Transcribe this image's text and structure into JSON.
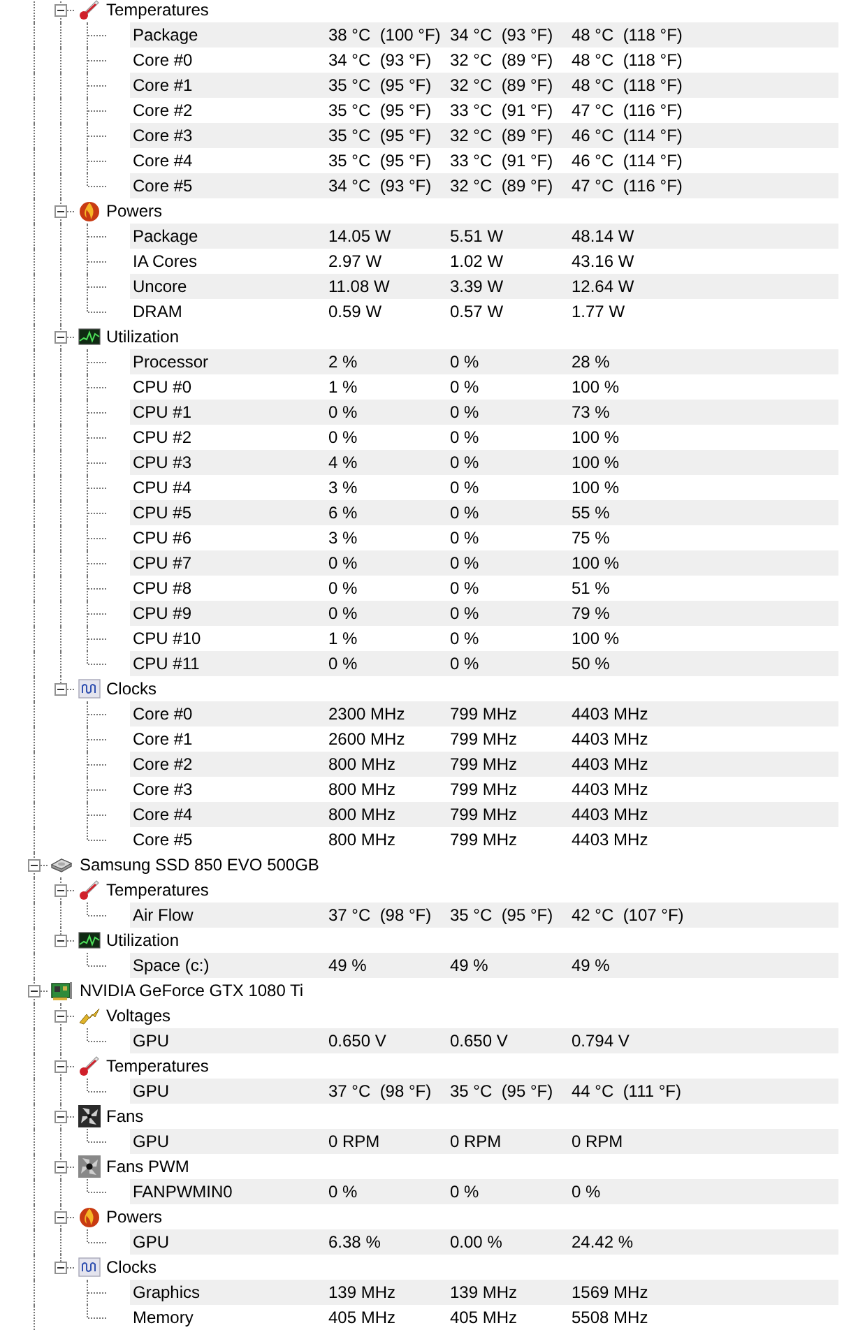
{
  "devices": [
    {
      "groups": [
        {
          "kind": "temperatures",
          "name": "Temperatures",
          "expanded": true,
          "sensors": [
            {
              "label": "Package",
              "values": [
                "38 °C  (100 °F)",
                "34 °C  (93 °F)",
                "48 °C  (118 °F)"
              ]
            },
            {
              "label": "Core #0",
              "values": [
                "34 °C  (93 °F)",
                "32 °C  (89 °F)",
                "48 °C  (118 °F)"
              ]
            },
            {
              "label": "Core #1",
              "values": [
                "35 °C  (95 °F)",
                "32 °C  (89 °F)",
                "48 °C  (118 °F)"
              ]
            },
            {
              "label": "Core #2",
              "values": [
                "35 °C  (95 °F)",
                "33 °C  (91 °F)",
                "47 °C  (116 °F)"
              ]
            },
            {
              "label": "Core #3",
              "values": [
                "35 °C  (95 °F)",
                "32 °C  (89 °F)",
                "46 °C  (114 °F)"
              ]
            },
            {
              "label": "Core #4",
              "values": [
                "35 °C  (95 °F)",
                "33 °C  (91 °F)",
                "46 °C  (114 °F)"
              ]
            },
            {
              "label": "Core #5",
              "values": [
                "34 °C  (93 °F)",
                "32 °C  (89 °F)",
                "47 °C  (116 °F)"
              ]
            }
          ]
        },
        {
          "kind": "powers",
          "name": "Powers",
          "expanded": true,
          "sensors": [
            {
              "label": "Package",
              "values": [
                "14.05 W",
                "5.51 W",
                "48.14 W"
              ]
            },
            {
              "label": "IA Cores",
              "values": [
                "2.97 W",
                "1.02 W",
                "43.16 W"
              ]
            },
            {
              "label": "Uncore",
              "values": [
                "11.08 W",
                "3.39 W",
                "12.64 W"
              ]
            },
            {
              "label": "DRAM",
              "values": [
                "0.59 W",
                "0.57 W",
                "1.77 W"
              ]
            }
          ]
        },
        {
          "kind": "utilization",
          "name": "Utilization",
          "expanded": true,
          "sensors": [
            {
              "label": "Processor",
              "values": [
                "2 %",
                "0 %",
                "28 %"
              ]
            },
            {
              "label": "CPU #0",
              "values": [
                "1 %",
                "0 %",
                "100 %"
              ]
            },
            {
              "label": "CPU #1",
              "values": [
                "0 %",
                "0 %",
                "73 %"
              ]
            },
            {
              "label": "CPU #2",
              "values": [
                "0 %",
                "0 %",
                "100 %"
              ]
            },
            {
              "label": "CPU #3",
              "values": [
                "4 %",
                "0 %",
                "100 %"
              ]
            },
            {
              "label": "CPU #4",
              "values": [
                "3 %",
                "0 %",
                "100 %"
              ]
            },
            {
              "label": "CPU #5",
              "values": [
                "6 %",
                "0 %",
                "55 %"
              ]
            },
            {
              "label": "CPU #6",
              "values": [
                "3 %",
                "0 %",
                "75 %"
              ]
            },
            {
              "label": "CPU #7",
              "values": [
                "0 %",
                "0 %",
                "100 %"
              ]
            },
            {
              "label": "CPU #8",
              "values": [
                "0 %",
                "0 %",
                "51 %"
              ]
            },
            {
              "label": "CPU #9",
              "values": [
                "0 %",
                "0 %",
                "79 %"
              ]
            },
            {
              "label": "CPU #10",
              "values": [
                "1 %",
                "0 %",
                "100 %"
              ]
            },
            {
              "label": "CPU #11",
              "values": [
                "0 %",
                "0 %",
                "50 %"
              ]
            }
          ]
        },
        {
          "kind": "clocks",
          "name": "Clocks",
          "expanded": true,
          "sensors": [
            {
              "label": "Core #0",
              "values": [
                "2300 MHz",
                "799 MHz",
                "4403 MHz"
              ]
            },
            {
              "label": "Core #1",
              "values": [
                "2600 MHz",
                "799 MHz",
                "4403 MHz"
              ]
            },
            {
              "label": "Core #2",
              "values": [
                "800 MHz",
                "799 MHz",
                "4403 MHz"
              ]
            },
            {
              "label": "Core #3",
              "values": [
                "800 MHz",
                "799 MHz",
                "4403 MHz"
              ]
            },
            {
              "label": "Core #4",
              "values": [
                "800 MHz",
                "799 MHz",
                "4403 MHz"
              ]
            },
            {
              "label": "Core #5",
              "values": [
                "800 MHz",
                "799 MHz",
                "4403 MHz"
              ]
            }
          ]
        }
      ]
    },
    {
      "kind": "drive",
      "name": "Samsung SSD 850 EVO 500GB",
      "expanded": true,
      "groups": [
        {
          "kind": "temperatures",
          "name": "Temperatures",
          "expanded": true,
          "sensors": [
            {
              "label": "Air Flow",
              "values": [
                "37 °C  (98 °F)",
                "35 °C  (95 °F)",
                "42 °C  (107 °F)"
              ]
            }
          ]
        },
        {
          "kind": "utilization",
          "name": "Utilization",
          "expanded": true,
          "sensors": [
            {
              "label": "Space (c:)",
              "values": [
                "49 %",
                "49 %",
                "49 %"
              ]
            }
          ]
        }
      ]
    },
    {
      "kind": "graphics-card",
      "name": "NVIDIA GeForce GTX 1080 Ti",
      "expanded": true,
      "groups": [
        {
          "kind": "voltages",
          "name": "Voltages",
          "expanded": true,
          "sensors": [
            {
              "label": "GPU",
              "values": [
                "0.650 V",
                "0.650 V",
                "0.794 V"
              ]
            }
          ]
        },
        {
          "kind": "temperatures",
          "name": "Temperatures",
          "expanded": true,
          "sensors": [
            {
              "label": "GPU",
              "values": [
                "37 °C  (98 °F)",
                "35 °C  (95 °F)",
                "44 °C  (111 °F)"
              ]
            }
          ]
        },
        {
          "kind": "fans",
          "name": "Fans",
          "expanded": true,
          "sensors": [
            {
              "label": "GPU",
              "values": [
                "0 RPM",
                "0 RPM",
                "0 RPM"
              ]
            }
          ]
        },
        {
          "kind": "fans-pwm",
          "name": "Fans PWM",
          "expanded": true,
          "sensors": [
            {
              "label": "FANPWMIN0",
              "values": [
                "0 %",
                "0 %",
                "0 %"
              ]
            }
          ]
        },
        {
          "kind": "powers",
          "name": "Powers",
          "expanded": true,
          "sensors": [
            {
              "label": "GPU",
              "values": [
                "6.38 %",
                "0.00 %",
                "24.42 %"
              ]
            }
          ]
        },
        {
          "kind": "clocks",
          "name": "Clocks",
          "expanded": true,
          "sensors": [
            {
              "label": "Graphics",
              "values": [
                "139 MHz",
                "139 MHz",
                "1569 MHz"
              ]
            },
            {
              "label": "Memory",
              "values": [
                "405 MHz",
                "405 MHz",
                "5508 MHz"
              ]
            }
          ]
        }
      ]
    }
  ]
}
